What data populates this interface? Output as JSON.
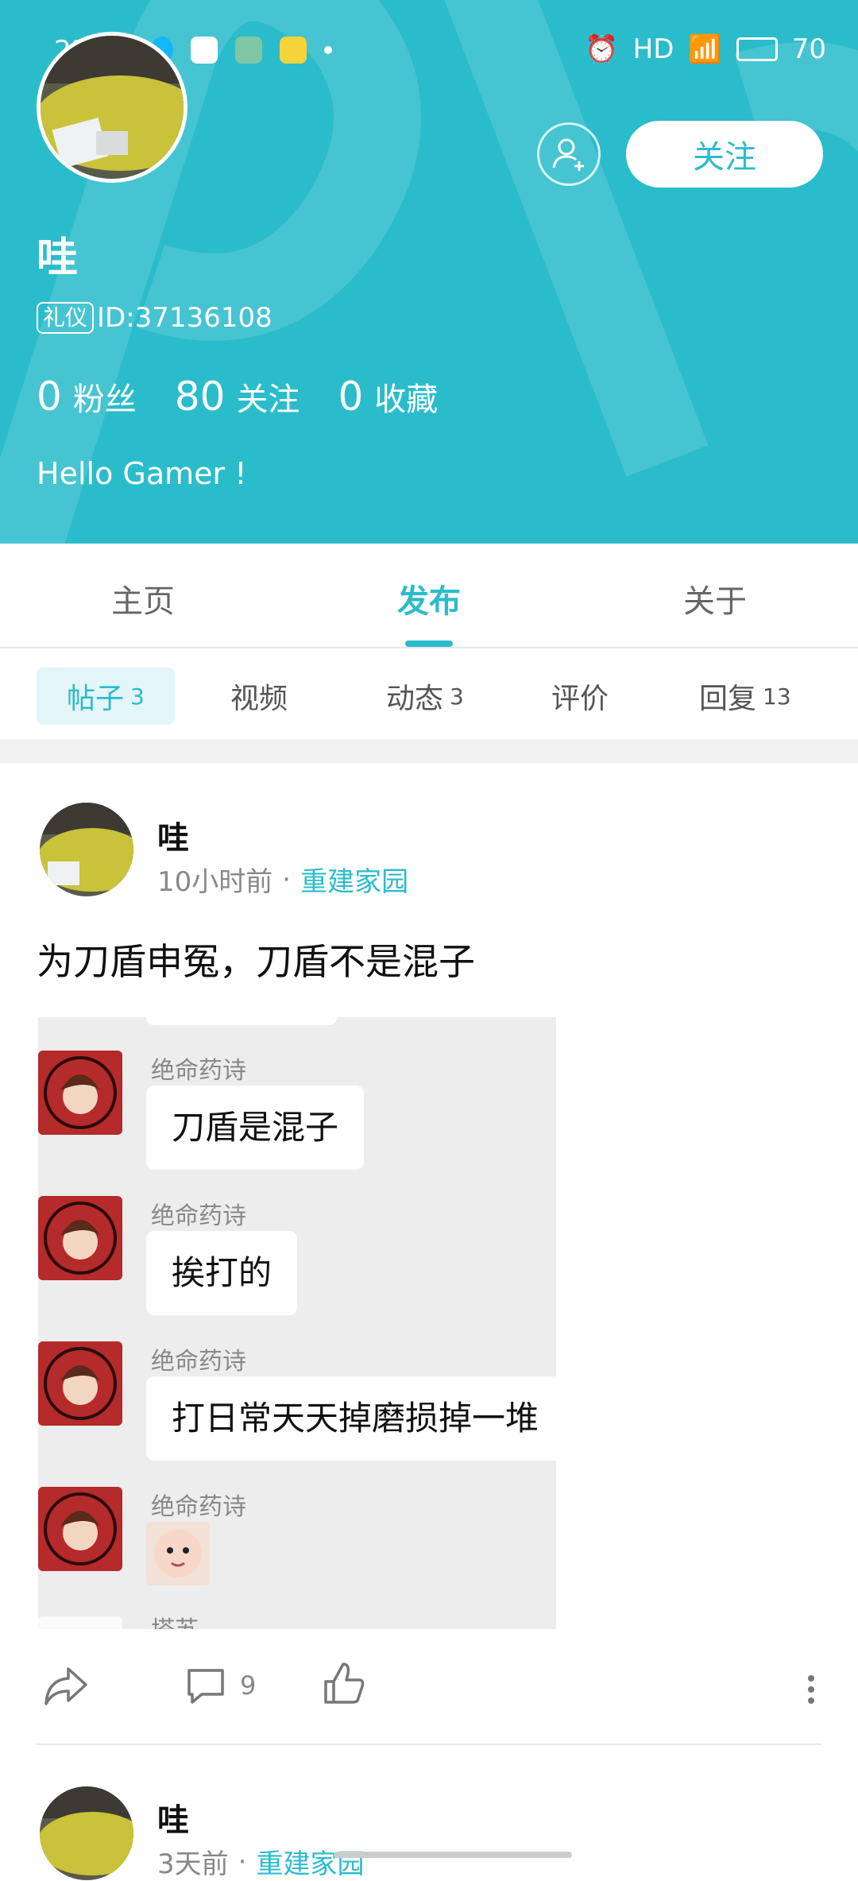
{
  "status_bar": {
    "time": "23:20",
    "network": "HD",
    "battery": "70",
    "icons": [
      "qq-icon",
      "bilibili-icon",
      "game-icon",
      "music-icon",
      "dot-icon",
      "alarm-icon",
      "signal-icon",
      "wifi-icon",
      "battery-icon"
    ]
  },
  "profile": {
    "name": "哇",
    "badge": "礼仪",
    "id_text": "ID:37136108",
    "follow_label": "关注",
    "bio": "Hello Gamer !",
    "stats": [
      {
        "num": "0",
        "label": "粉丝"
      },
      {
        "num": "80",
        "label": "关注"
      },
      {
        "num": "0",
        "label": "收藏"
      }
    ]
  },
  "tabs": {
    "items": [
      "主页",
      "发布",
      "关于"
    ],
    "active": "发布"
  },
  "subtabs": [
    {
      "label": "帖子",
      "count": "3"
    },
    {
      "label": "视频",
      "count": ""
    },
    {
      "label": "动态",
      "count": "3"
    },
    {
      "label": "评价",
      "count": ""
    },
    {
      "label": "回复",
      "count": "13"
    }
  ],
  "posts": [
    {
      "author": "哇",
      "time": "10小时前",
      "dot": "·",
      "forum": "重建家园",
      "title": "为刀盾申冤，刀盾不是混子",
      "comment_count": "9",
      "screenshot_messages": [
        {
          "name": "绝命药诗",
          "text": "刀盾是混子"
        },
        {
          "name": "绝命药诗",
          "text": "挨打的"
        },
        {
          "name": "绝命药诗",
          "text": "打日常天天掉磨损掉一堆"
        },
        {
          "name": "绝命药诗",
          "text": ""
        }
      ],
      "next_name_fragment": "塔苏"
    },
    {
      "author": "哇",
      "time": "3天前",
      "dot": "·",
      "forum": "重建家园"
    }
  ],
  "colors": {
    "accent": "#2bbccb",
    "header_bg": "#2bbccb",
    "text_primary": "#111111",
    "text_secondary": "#888888"
  }
}
